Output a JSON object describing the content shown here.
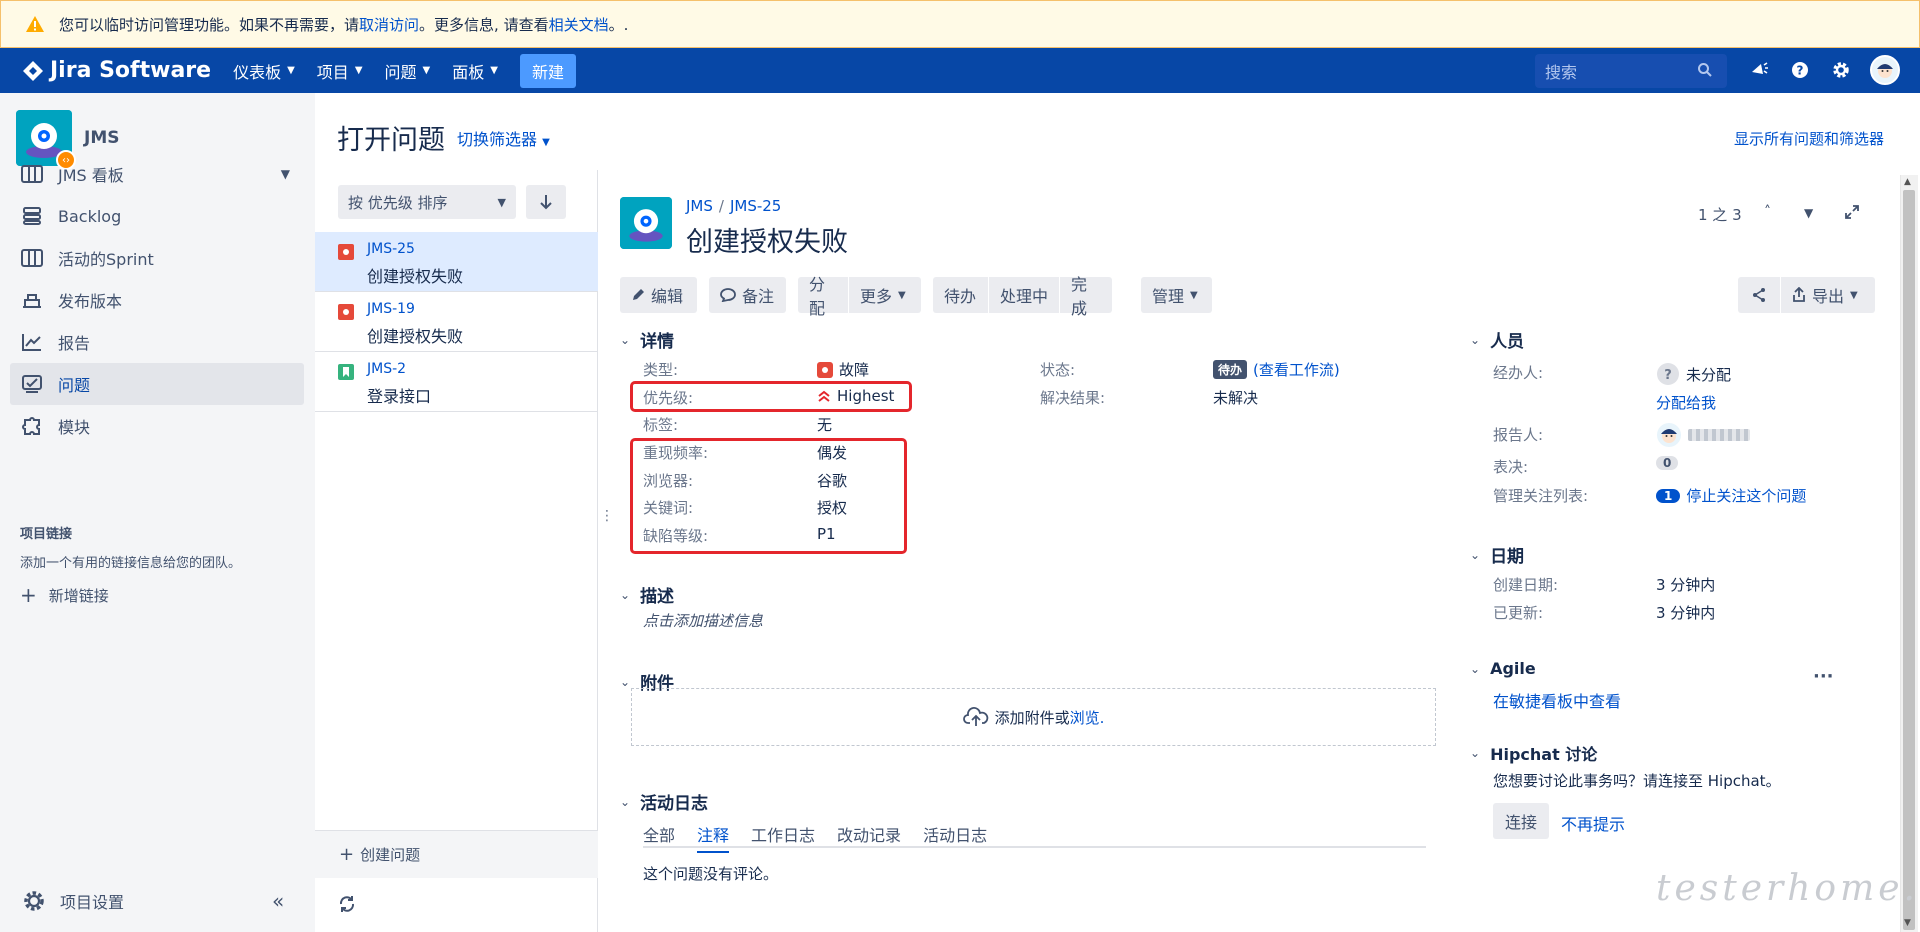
{
  "banner": {
    "text1": "您可以临时访问管理功能。如果不再需要，请 ",
    "cancel_link": "取消访问",
    "text2": "。更多信息, 请查看 ",
    "docs_link": "相关文档",
    "text3": "。."
  },
  "topnav": {
    "logo": "Jira Software",
    "items": [
      "仪表板",
      "项目",
      "问题",
      "面板"
    ],
    "create": "新建",
    "search_placeholder": "搜索"
  },
  "sidebar": {
    "project_name": "JMS",
    "items": [
      {
        "label": "JMS 看板",
        "icon": "board-icon"
      },
      {
        "label": "Backlog",
        "icon": "backlog-icon"
      },
      {
        "label": "活动的Sprint",
        "icon": "sprint-icon"
      },
      {
        "label": "发布版本",
        "icon": "release-icon"
      },
      {
        "label": "报告",
        "icon": "reports-icon"
      },
      {
        "label": "问题",
        "icon": "issues-icon"
      },
      {
        "label": "模块",
        "icon": "components-icon"
      }
    ],
    "links_heading": "项目链接",
    "links_hint": "添加一个有用的链接信息给您的团队。",
    "add_link": "新增链接",
    "settings": "项目设置"
  },
  "header": {
    "title": "打开问题",
    "switch_filter": "切换筛选器",
    "show_all": "显示所有问题和筛选器"
  },
  "list": {
    "sort_label": "按 优先级 排序",
    "issues": [
      {
        "key": "JMS-25",
        "summary": "创建授权失败",
        "type": "bug"
      },
      {
        "key": "JMS-19",
        "summary": "创建授权失败",
        "type": "bug"
      },
      {
        "key": "JMS-2",
        "summary": "登录接口",
        "type": "story"
      }
    ],
    "create_issue": "创建问题"
  },
  "issue": {
    "project": "JMS",
    "key": "JMS-25",
    "title": "创建授权失败",
    "pager": "1 之 3",
    "toolbar": {
      "edit": "编辑",
      "comment": "备注",
      "assign": "分配",
      "more": "更多",
      "todo": "待办",
      "in_progress": "处理中",
      "done": "完成",
      "admin": "管理",
      "export": "导出"
    },
    "details_heading": "详情",
    "fields": {
      "type_label": "类型:",
      "type_value": "故障",
      "priority_label": "优先级:",
      "priority_value": "Highest",
      "labels_label": "标签:",
      "labels_value": "无",
      "freq_label": "重现频率:",
      "freq_value": "偶发",
      "browser_label": "浏览器:",
      "browser_value": "谷歌",
      "keyword_label": "关键词:",
      "keyword_value": "授权",
      "severity_label": "缺陷等级:",
      "severity_value": "P1",
      "status_label": "状态:",
      "status_lozenge": "待办",
      "status_workflow": "(查看工作流)",
      "resolution_label": "解决结果:",
      "resolution_value": "未解决"
    },
    "description_heading": "描述",
    "description_placeholder": "点击添加描述信息",
    "attachments_heading": "附件",
    "attachments_drop": "添加附件或 ",
    "attachments_browse": "浏览.",
    "activity_heading": "活动日志",
    "activity_tabs": [
      "全部",
      "注释",
      "工作日志",
      "改动记录",
      "活动日志"
    ],
    "no_comments": "这个问题没有评论。"
  },
  "right": {
    "people_heading": "人员",
    "assignee_label": "经办人:",
    "assignee_value": "未分配",
    "assign_to_me": "分配给我",
    "reporter_label": "报告人:",
    "votes_label": "表决:",
    "votes_value": "0",
    "watchers_label": "管理关注列表:",
    "watchers_count": "1",
    "watchers_action": "停止关注这个问题",
    "dates_heading": "日期",
    "created_label": "创建日期:",
    "created_value": "3 分钟内",
    "updated_label": "已更新:",
    "updated_value": "3 分钟内",
    "agile_heading": "Agile",
    "agile_link": "在敏捷看板中查看",
    "hipchat_heading": "Hipchat 讨论",
    "hipchat_text": "您想要讨论此事务吗？请连接至 Hipchat。",
    "connect": "连接",
    "dismiss": "不再提示"
  },
  "watermark": "testerhome.com",
  "colors": {
    "nav": "#0747a6",
    "accent": "#0052cc",
    "highlight": "#e4262c",
    "bug": "#e5493a",
    "story": "#36b37e"
  }
}
